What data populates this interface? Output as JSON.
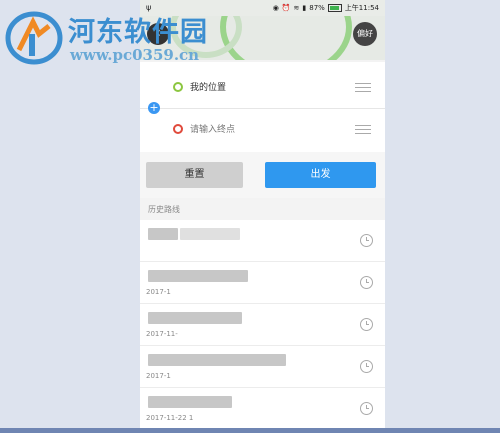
{
  "status_bar": {
    "battery": "87%",
    "time": "上午11:54"
  },
  "map": {
    "back_icon": "chevron-left-icon",
    "preference_label": "偏好"
  },
  "route": {
    "start_label": "我的位置",
    "end_placeholder": "请输入终点",
    "add_icon": "plus-icon",
    "colors": {
      "start": "#8cc640",
      "end": "#e04a3c"
    }
  },
  "actions": {
    "reset_label": "重置",
    "go_label": "出发",
    "go_color": "#2f98ef"
  },
  "history": {
    "section_label": "历史路线",
    "items": [
      {
        "date": ""
      },
      {
        "date": "2017-1"
      },
      {
        "date": "2017-11-"
      },
      {
        "date": "2017-1"
      },
      {
        "date": "2017-11-22 1"
      }
    ]
  },
  "watermark": {
    "site_name": "河东软件园",
    "url": "www.pc0359.cn"
  }
}
